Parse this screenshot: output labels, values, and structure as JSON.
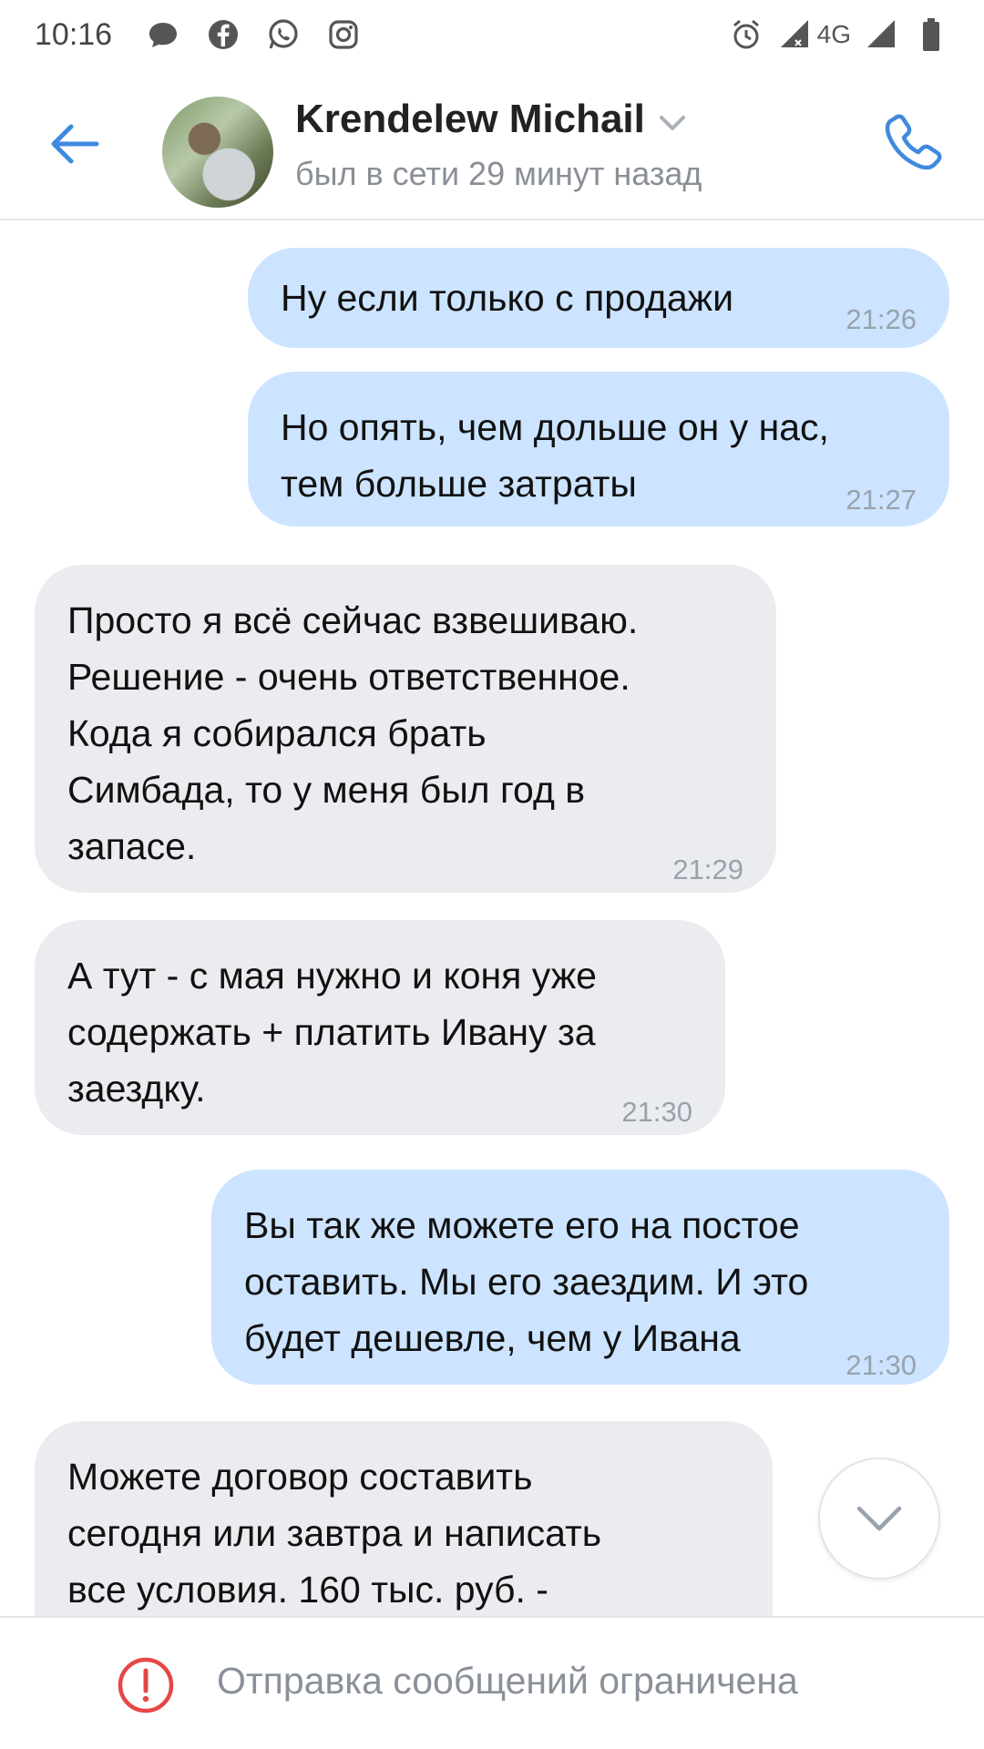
{
  "status_bar": {
    "time": "10:16",
    "network": "4G",
    "left_icons": [
      "chat-bubble-icon",
      "facebook-icon",
      "whatsapp-icon",
      "instagram-icon"
    ],
    "right_icons": [
      "alarm-icon",
      "signal-icon",
      "signal-icon-2",
      "battery-icon"
    ]
  },
  "header": {
    "contact_name": "Krendelew Michail",
    "last_seen": "был в сети 29 минут назад",
    "accent_color": "#3f8ae0"
  },
  "messages": [
    {
      "direction": "out",
      "text": "Ну если только с продажи",
      "time": "21:26"
    },
    {
      "direction": "out",
      "lines": [
        "Но опять, чем дольше он у нас,",
        "тем больше затраты"
      ],
      "time": "21:27"
    },
    {
      "direction": "in",
      "lines": [
        "Просто я всё сейчас взвешиваю.",
        "Решение - очень ответственное.",
        "Кода я собирался брать",
        "Симбада, то у меня был год в",
        "запасе."
      ],
      "time": "21:29"
    },
    {
      "direction": "in",
      "lines": [
        "А тут - с мая нужно и коня уже",
        "содержать + платить Ивану за",
        "заездку."
      ],
      "time": "21:30"
    },
    {
      "direction": "out",
      "lines": [
        "Вы так же можете его на постое",
        "оставить. Мы его заездим. И это",
        "будет дешевле, чем у Ивана"
      ],
      "time": "21:30"
    },
    {
      "direction": "in",
      "lines": [
        "Можете договор составить",
        "сегодня или завтра и написать",
        "все условия. 160 тыс. руб. -"
      ]
    }
  ],
  "bottom_bar": {
    "text": "Отправка сообщений ограничена",
    "icon": "warning-icon",
    "icon_color": "#e64646"
  }
}
